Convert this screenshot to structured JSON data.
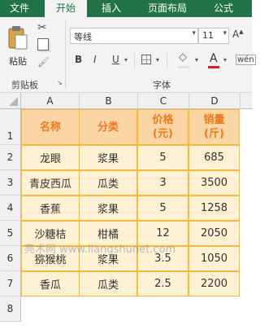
{
  "tabs": [
    "文件",
    "开始",
    "插入",
    "页面布局",
    "公式"
  ],
  "active_tab": "开始",
  "clipboard": {
    "paste_label": "粘贴",
    "group_label": "剪贴板"
  },
  "font": {
    "name": "等线",
    "size": "11",
    "group_label": "字体",
    "bold": "B",
    "italic": "I",
    "underline": "U",
    "font_color_letter": "A",
    "accent_red": "#e02020"
  },
  "columns": [
    "A",
    "B",
    "C",
    "D"
  ],
  "rows": [
    "1",
    "2",
    "3",
    "4",
    "5",
    "6",
    "7",
    "8"
  ],
  "table": {
    "headers": [
      "名称",
      "分类",
      "价格\n(元)",
      "销量\n(斤)"
    ],
    "data": [
      [
        "龙眼",
        "浆果",
        "5",
        "685"
      ],
      [
        "青皮西瓜",
        "瓜类",
        "3",
        "3500"
      ],
      [
        "香蕉",
        "浆果",
        "5",
        "1258"
      ],
      [
        "沙糖桔",
        "柑橘",
        "12",
        "2050"
      ],
      [
        "猕猴桃",
        "浆果",
        "3.5",
        "1050"
      ],
      [
        "香瓜",
        "瓜类",
        "2.5",
        "2200"
      ]
    ]
  },
  "watermark": "亮术网 www.liangshunet.com",
  "colors": {
    "excel_green": "#217346",
    "header_fill": "#fcd5a4",
    "header_text": "#ec7a20",
    "data_fill": "#fff1d4",
    "border": "#f5b93c"
  }
}
